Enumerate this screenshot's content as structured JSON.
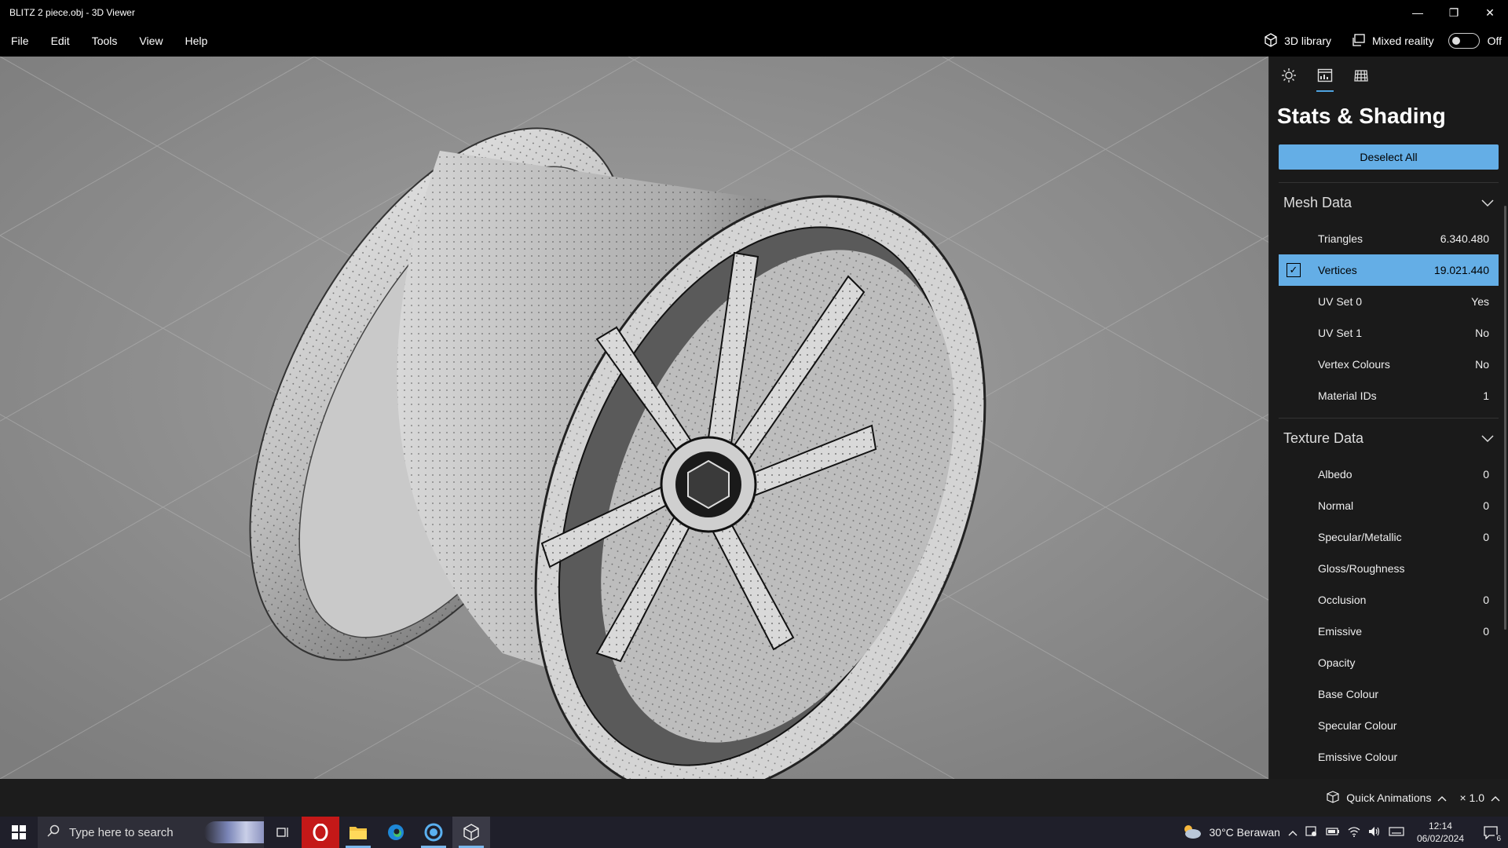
{
  "window": {
    "title": "BLITZ 2 piece.obj - 3D Viewer"
  },
  "menu": {
    "items": [
      "File",
      "Edit",
      "Tools",
      "View",
      "Help"
    ]
  },
  "topright": {
    "library_label": "3D library",
    "mixed_reality_label": "Mixed reality",
    "toggle_state": "Off"
  },
  "panel": {
    "title": "Stats & Shading",
    "deselect_label": "Deselect All",
    "mesh_section": "Mesh Data",
    "mesh_rows": [
      {
        "label": "Triangles",
        "value": "6.340.480"
      },
      {
        "label": "Vertices",
        "value": "19.021.440",
        "selected": true
      },
      {
        "label": "UV Set 0",
        "value": "Yes"
      },
      {
        "label": "UV Set 1",
        "value": "No"
      },
      {
        "label": "Vertex Colours",
        "value": "No"
      },
      {
        "label": "Material IDs",
        "value": "1"
      }
    ],
    "texture_section": "Texture Data",
    "texture_rows": [
      {
        "label": "Albedo",
        "value": "0"
      },
      {
        "label": "Normal",
        "value": "0"
      },
      {
        "label": "Specular/Metallic",
        "value": "0"
      },
      {
        "label": "Gloss/Roughness",
        "value": ""
      },
      {
        "label": "Occlusion",
        "value": "0"
      },
      {
        "label": "Emissive",
        "value": "0"
      },
      {
        "label": "Opacity",
        "value": ""
      },
      {
        "label": "Base Colour",
        "value": ""
      },
      {
        "label": "Specular Colour",
        "value": ""
      },
      {
        "label": "Emissive Colour",
        "value": ""
      }
    ]
  },
  "status": {
    "quick_animations": "Quick Animations",
    "speed": "× 1.0"
  },
  "taskbar": {
    "search_placeholder": "Type here to search",
    "weather": "30°C  Berawan",
    "time": "12:14",
    "date": "06/02/2024",
    "notification_count": "6"
  },
  "colors": {
    "accent": "#64aee6",
    "viewport": "#8e8e8e",
    "panel": "#1a1a1a"
  }
}
